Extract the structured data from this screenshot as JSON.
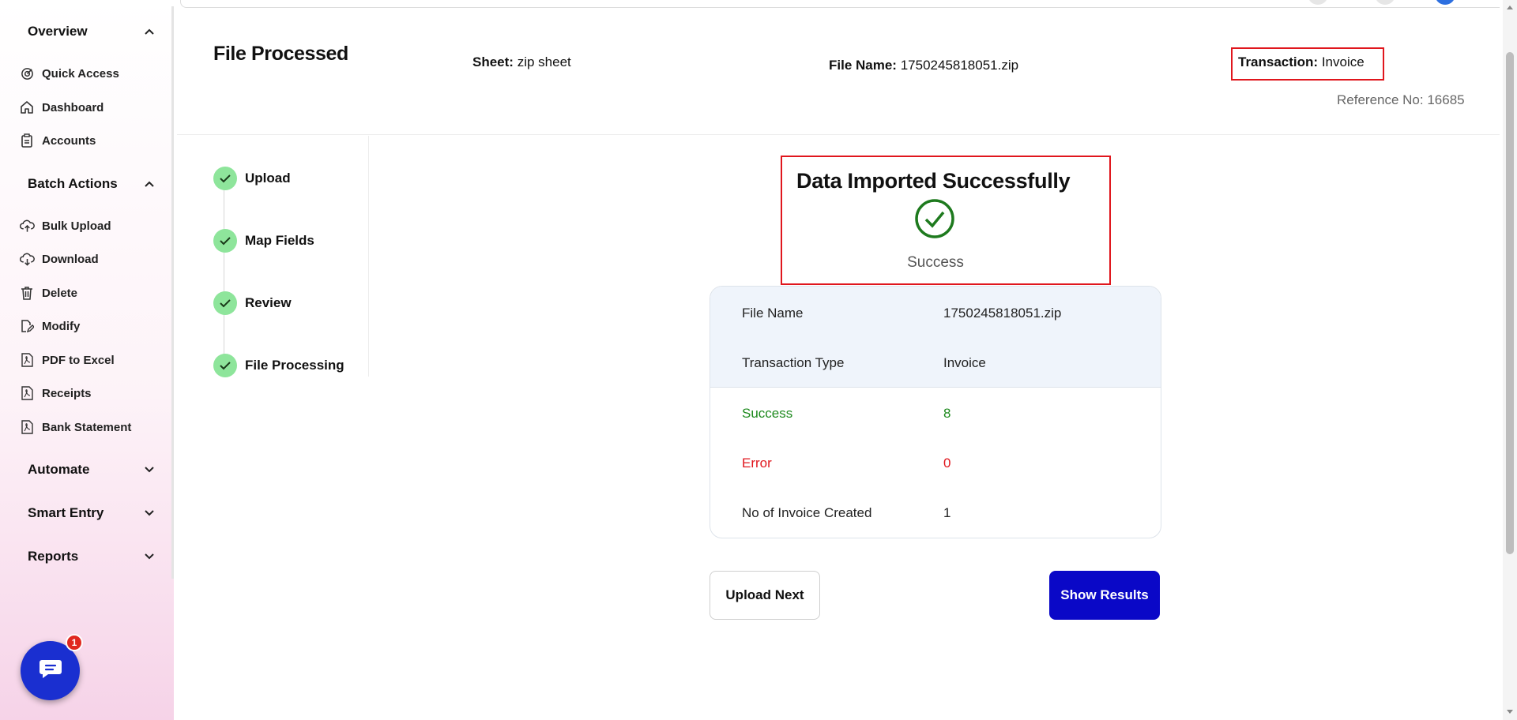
{
  "sidebar": {
    "overview": "Overview",
    "quick_access": "Quick Access",
    "dashboard": "Dashboard",
    "accounts": "Accounts",
    "batch_actions": "Batch Actions",
    "bulk_upload": "Bulk Upload",
    "download": "Download",
    "delete": "Delete",
    "modify": "Modify",
    "pdf_to_excel": "PDF to Excel",
    "receipts": "Receipts",
    "bank_statement": "Bank Statement",
    "automate": "Automate",
    "smart_entry": "Smart Entry",
    "reports": "Reports"
  },
  "chat": {
    "badge": "1"
  },
  "header": {
    "title": "File Processed",
    "sheet_label": "Sheet:",
    "sheet_value": "zip sheet",
    "file_label": "File Name:",
    "file_value": "1750245818051.zip",
    "transaction_label": "Transaction:",
    "transaction_value": "Invoice",
    "reference": "Reference No: 16685"
  },
  "steps": {
    "upload": "Upload",
    "map_fields": "Map Fields",
    "review": "Review",
    "file_processing": "File Processing"
  },
  "result": {
    "title": "Data Imported Successfully",
    "status": "Success",
    "file_name_label": "File Name",
    "file_name_value": "1750245818051.zip",
    "transaction_type_label": "Transaction Type",
    "transaction_type_value": "Invoice",
    "success_label": "Success",
    "success_value": "8",
    "error_label": "Error",
    "error_value": "0",
    "invoices_label": "No of Invoice Created",
    "invoices_value": "1"
  },
  "buttons": {
    "upload_next": "Upload Next",
    "show_results": "Show Results"
  },
  "colors": {
    "primary": "#0a08c7",
    "success": "#1e8a1e",
    "error": "#e0161d",
    "step_done": "#8ee59b",
    "highlight_box": "#e0161d"
  }
}
